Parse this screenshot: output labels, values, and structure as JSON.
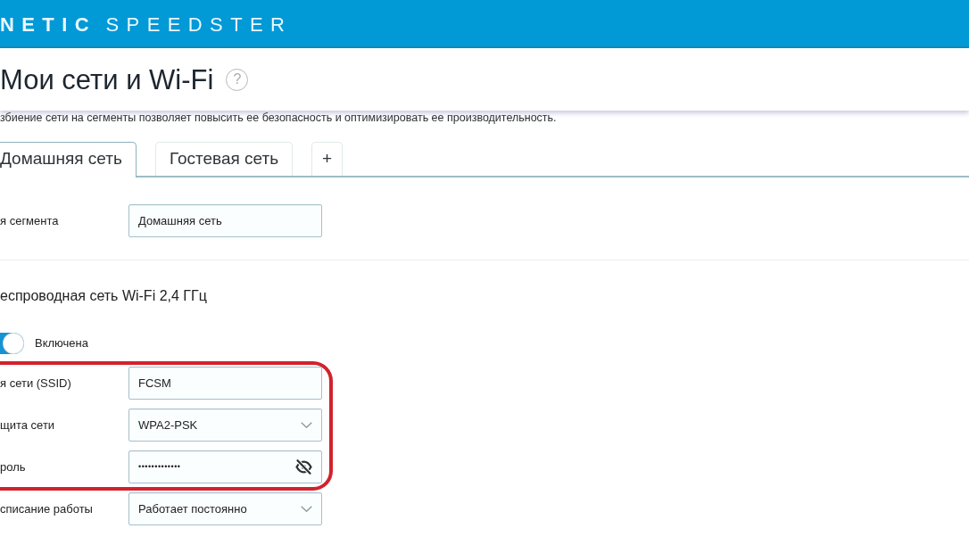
{
  "header": {
    "logo": "**NETIC** SPEEDSTER"
  },
  "page": {
    "title": "Мои сети и Wi-Fi",
    "help": "?",
    "description": "збиение сети на сегменты позволяет повысить ее безопасность и оптимизировать ее производительность."
  },
  "tabs": [
    {
      "label": "Домашняя сеть",
      "selected": true
    },
    {
      "label": "Гостевая сеть",
      "selected": false
    },
    {
      "label": "+",
      "selected": false
    }
  ],
  "segment": {
    "label": "я сегмента",
    "value": "Домашняя сеть"
  },
  "wifi": {
    "title": "еспроводная сеть Wi-Fi 2,4 ГГц",
    "toggle": {
      "on": true,
      "label": "Включена"
    },
    "fields": [
      {
        "kind": "text",
        "label": "я сети (SSID)",
        "value": "FCSM",
        "highlighted": true
      },
      {
        "kind": "select",
        "label": "щита сети",
        "value": "WPA2-PSK",
        "highlighted": true
      },
      {
        "kind": "password",
        "label": "роль",
        "value": "•••••••••••••",
        "highlighted": true
      },
      {
        "kind": "select",
        "label": "списание работы",
        "value": "Работает постоянно",
        "highlighted": false
      }
    ]
  }
}
